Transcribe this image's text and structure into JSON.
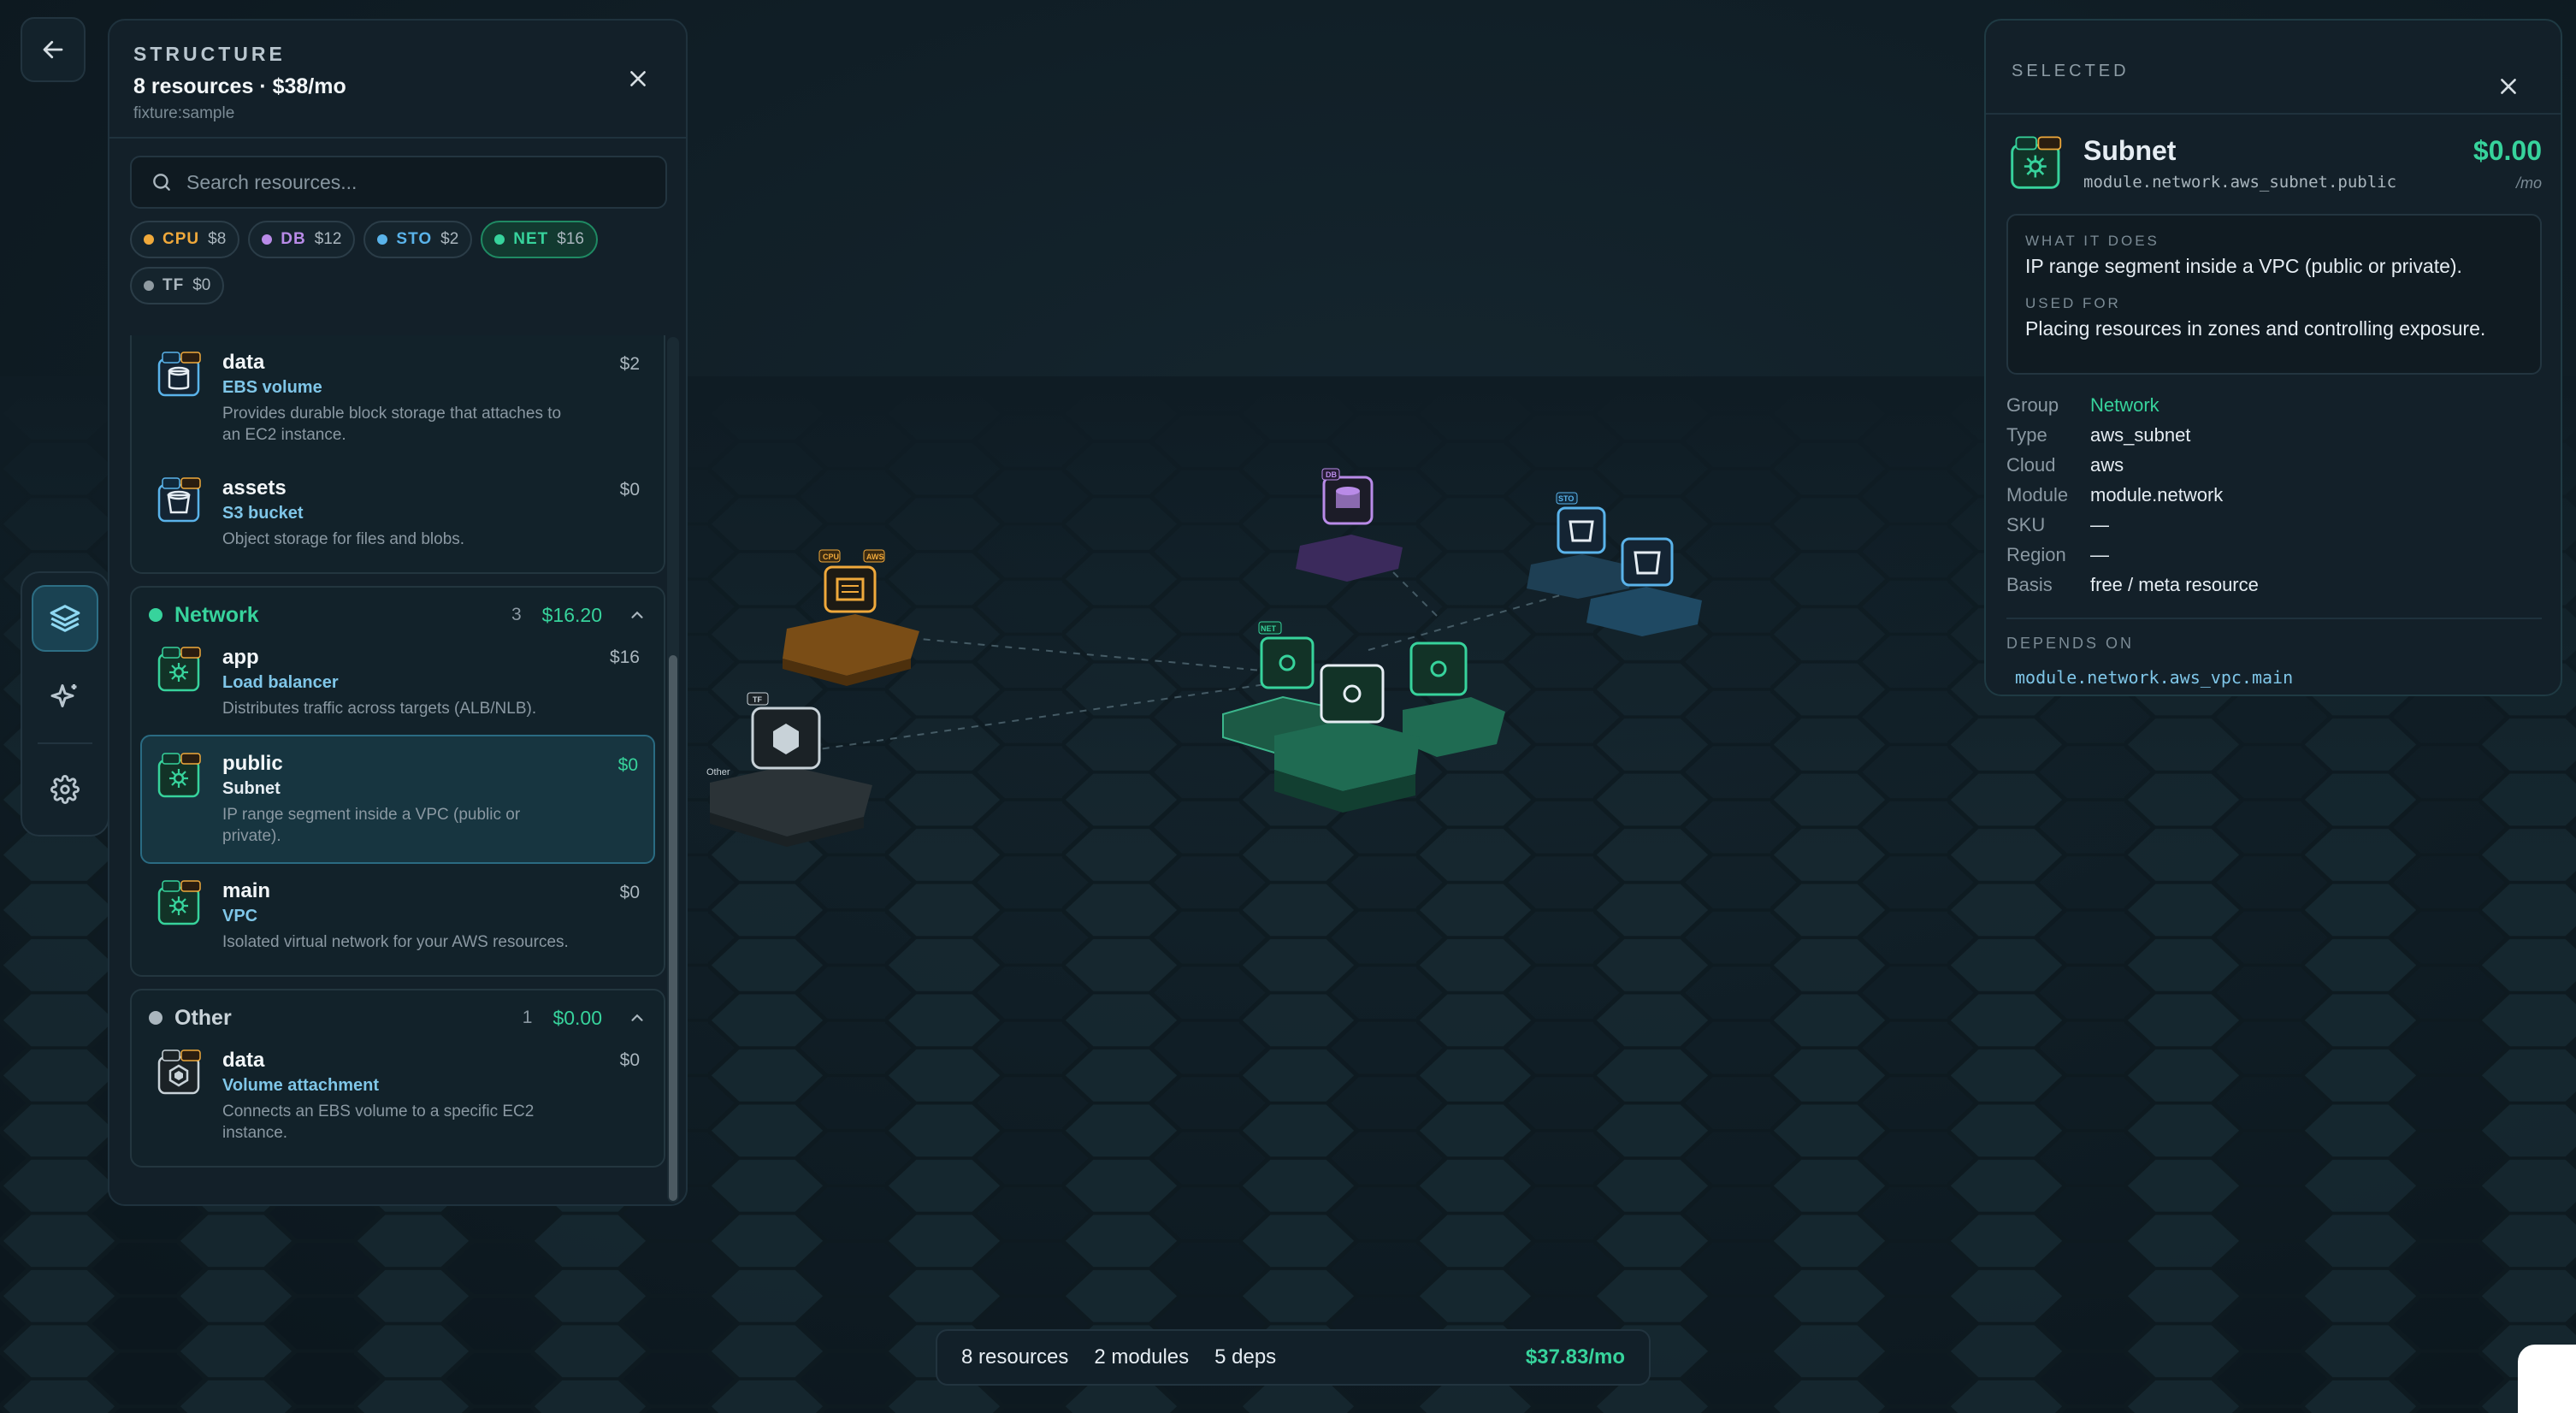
{
  "colors": {
    "background": "#0f1c24",
    "accent_green": "#37d39c",
    "cpu": "#f0a93b",
    "db": "#b98be8",
    "sto": "#5ab3ea",
    "net": "#37d39c",
    "tf": "#8f9aa1",
    "network_tile": "#1f6b52",
    "compute_tile": "#7a4d16",
    "db_tile": "#3b2a5c",
    "storage_tile": "#1f4963"
  },
  "structure": {
    "kicker": "STRUCTURE",
    "title": "8 resources · $38/mo",
    "subtitle": "fixture:sample",
    "search_placeholder": "Search resources...",
    "chips": [
      {
        "key": "CPU",
        "value": "$8",
        "color": "#f0a93b"
      },
      {
        "key": "DB",
        "value": "$12",
        "color": "#b98be8"
      },
      {
        "key": "STO",
        "value": "$2",
        "color": "#5ab3ea"
      },
      {
        "key": "NET",
        "value": "$16",
        "color": "#37d39c"
      },
      {
        "key": "TF",
        "value": "$0",
        "color": "#8f9aa1"
      }
    ],
    "storage_items": [
      {
        "name": "data",
        "kind": "EBS volume",
        "desc": "Provides durable block storage that attaches to an EC2 instance.",
        "cost": "$2",
        "icon": "storage-volume-icon"
      },
      {
        "name": "assets",
        "kind": "S3 bucket",
        "desc": "Object storage for files and blobs.",
        "cost": "$0",
        "icon": "bucket-icon"
      }
    ],
    "network": {
      "name": "Network",
      "count": "3",
      "cost": "$16.20",
      "items": [
        {
          "name": "app",
          "kind": "Load balancer",
          "desc": "Distributes traffic across targets (ALB/NLB).",
          "cost": "$16",
          "icon": "network-hub-icon"
        },
        {
          "name": "public",
          "kind": "Subnet",
          "desc": "IP range segment inside a VPC (public or private).",
          "cost": "$0",
          "icon": "network-hub-icon"
        },
        {
          "name": "main",
          "kind": "VPC",
          "desc": "Isolated virtual network for your AWS resources.",
          "cost": "$0",
          "icon": "network-hub-icon"
        }
      ]
    },
    "other": {
      "name": "Other",
      "count": "1",
      "cost": "$0.00",
      "items": [
        {
          "name": "data",
          "kind": "Volume attachment",
          "desc": "Connects an EBS volume to a specific EC2 instance.",
          "cost": "$0",
          "icon": "hexagon-box-icon"
        }
      ]
    }
  },
  "selected": {
    "kicker": "SELECTED",
    "title": "Subnet",
    "address": "module.network.aws_subnet.public",
    "price": "$0.00",
    "per": "/mo",
    "what_label": "WHAT IT DOES",
    "what": "IP range segment inside a VPC (public or private).",
    "used_label": "USED FOR",
    "used": "Placing resources in zones and controlling exposure.",
    "props": [
      {
        "k": "Group",
        "v": "Network"
      },
      {
        "k": "Type",
        "v": "aws_subnet"
      },
      {
        "k": "Cloud",
        "v": "aws"
      },
      {
        "k": "Module",
        "v": "module.network"
      },
      {
        "k": "SKU",
        "v": "—"
      },
      {
        "k": "Region",
        "v": "—"
      },
      {
        "k": "Basis",
        "v": "free / meta resource"
      }
    ],
    "depends_label": "DEPENDS ON",
    "depends": "module.network.aws_vpc.main"
  },
  "bottom": {
    "resources": "8 resources",
    "modules": "2 modules",
    "deps": "5 deps",
    "total": "$37.83/mo"
  },
  "scene_badges": {
    "cpu": "CPU",
    "aws": "AWS",
    "net": "NET",
    "db": "DB",
    "sto": "STO",
    "tf": "TF",
    "other_label": "Other"
  }
}
